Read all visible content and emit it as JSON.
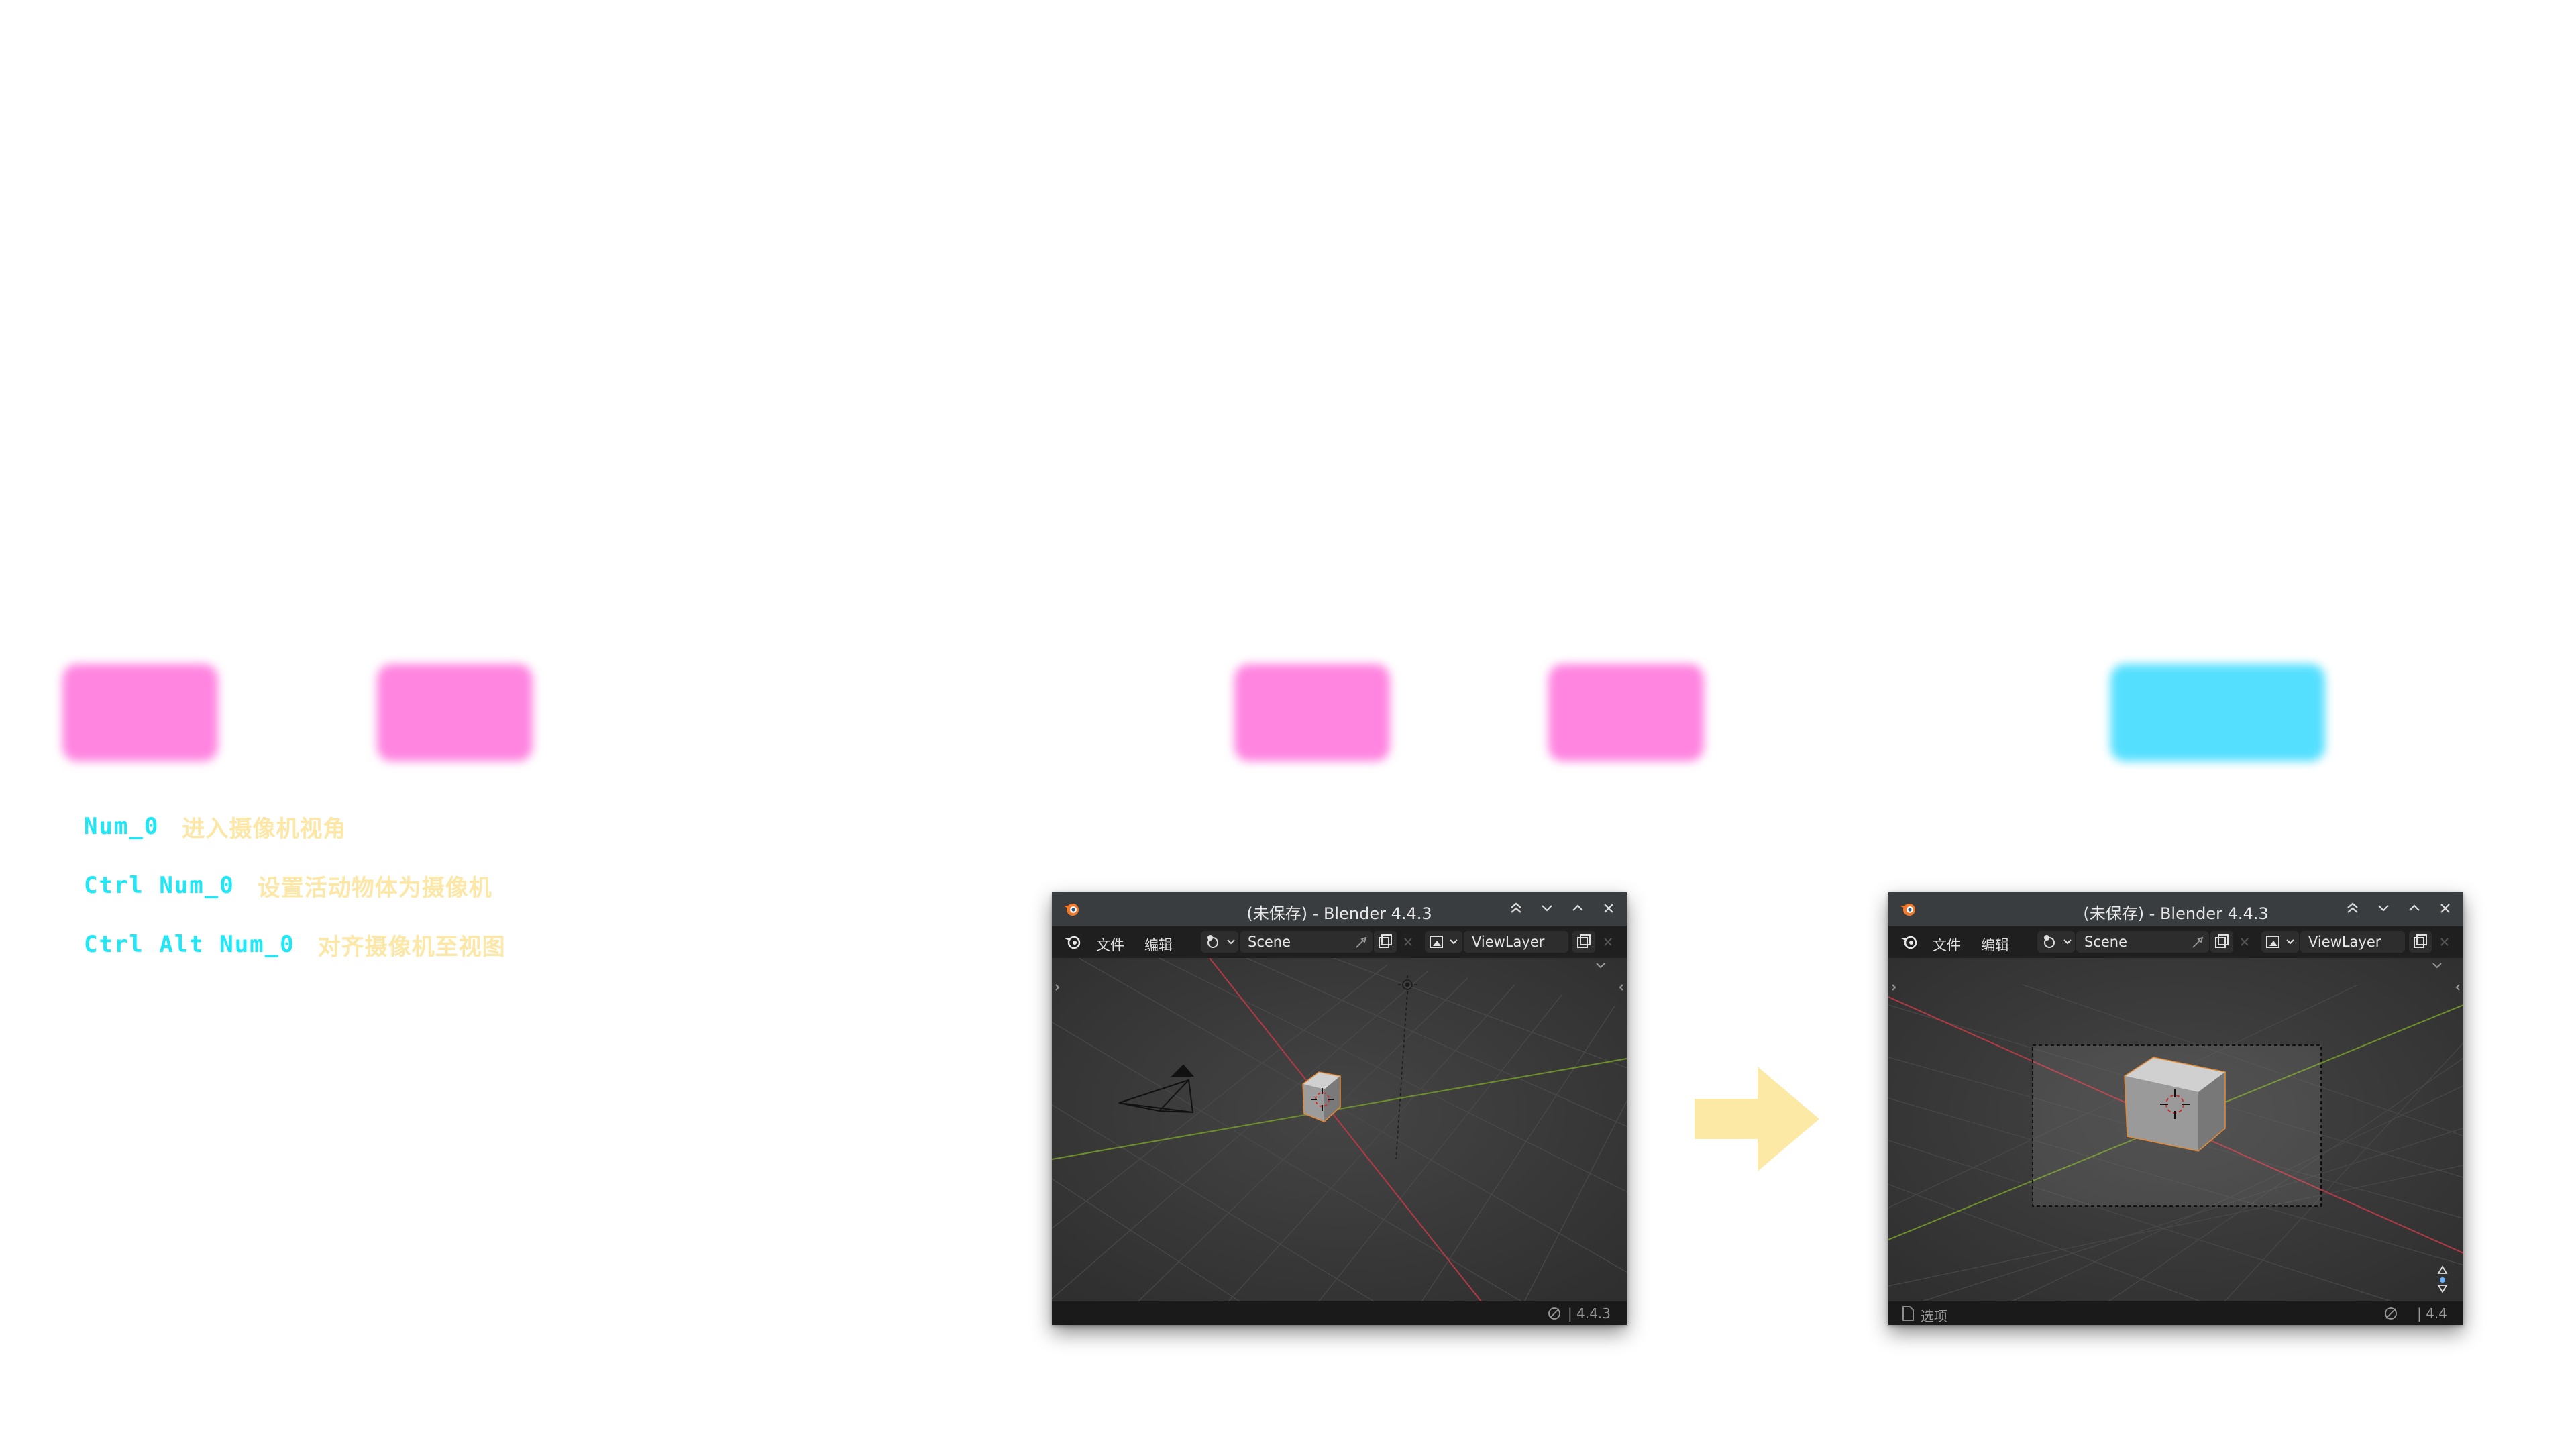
{
  "blobs": [
    {
      "name": "highlight-1",
      "color": "#ff85e0"
    },
    {
      "name": "highlight-2",
      "color": "#ff85e0"
    },
    {
      "name": "highlight-3",
      "color": "#ff85e0"
    },
    {
      "name": "highlight-4",
      "color": "#ff85e0"
    },
    {
      "name": "highlight-5",
      "color": "#55dfff"
    }
  ],
  "shortcuts": [
    {
      "key": "Num_0",
      "desc": "进入摄像机视角"
    },
    {
      "key": "Ctrl Num_0",
      "desc": "设置活动物体为摄像机"
    },
    {
      "key": "Ctrl Alt Num_0",
      "desc": "对齐摄像机至视图"
    }
  ],
  "colors": {
    "key": "#1ee8f5",
    "desc": "#fde7a6",
    "arrow": "#fde9a6",
    "x_axis": "#b33a45",
    "y_axis": "#6f8f2a"
  },
  "windows": [
    {
      "title": "(未保存) - Blender 4.4.3",
      "menu": [
        "文件",
        "编辑"
      ],
      "scene": "Scene",
      "view_layer": "ViewLayer",
      "version": "4.4.3",
      "status_left": ""
    },
    {
      "title": "(未保存) - Blender 4.4.3",
      "menu": [
        "文件",
        "编辑"
      ],
      "scene": "Scene",
      "view_layer": "ViewLayer",
      "version": "4.4",
      "status_left": "选项"
    }
  ],
  "icons": {
    "logo": "blender-logo-icon",
    "window_controls": [
      "keep-above-icon",
      "minimize-icon",
      "maximize-icon",
      "close-icon"
    ],
    "arrow": "right-arrow-icon"
  }
}
